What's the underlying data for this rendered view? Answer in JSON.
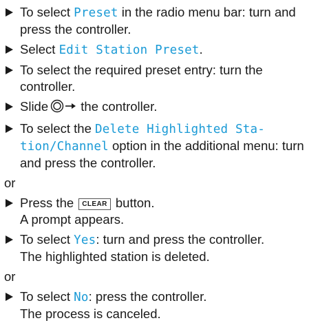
{
  "steps_a": [
    {
      "pre": "To select ",
      "menu": "Preset",
      "post": " in the radio menu bar: turn and press the controller."
    },
    {
      "pre": "Select ",
      "menu": "Edit Station Preset",
      "post": "."
    },
    {
      "pre": "To select the required preset entry: turn the controller.",
      "menu": "",
      "post": ""
    },
    {
      "pre": "Slide",
      "icon": "controller-slide-right-icon",
      "post": " the controller."
    },
    {
      "pre": "To select the ",
      "menu": "Delete Highlighted Sta-tion/Channel",
      "post": " option in the additional menu: turn and press the controller."
    }
  ],
  "or_label": "or",
  "step_b": {
    "pre": "Press the ",
    "key": "CLEAR",
    "post": " button.",
    "result": "A prompt appears."
  },
  "step_c": {
    "pre": "To select ",
    "menu": "Yes",
    "post": ": turn and press the controller.",
    "result": "The highlighted station is deleted."
  },
  "step_d": {
    "pre": "To select ",
    "menu": "No",
    "post": ": press the controller.",
    "result": "The process is canceled."
  },
  "colors": {
    "menu_text": "#1a9ad6",
    "body_text": "#1a1a1a"
  }
}
